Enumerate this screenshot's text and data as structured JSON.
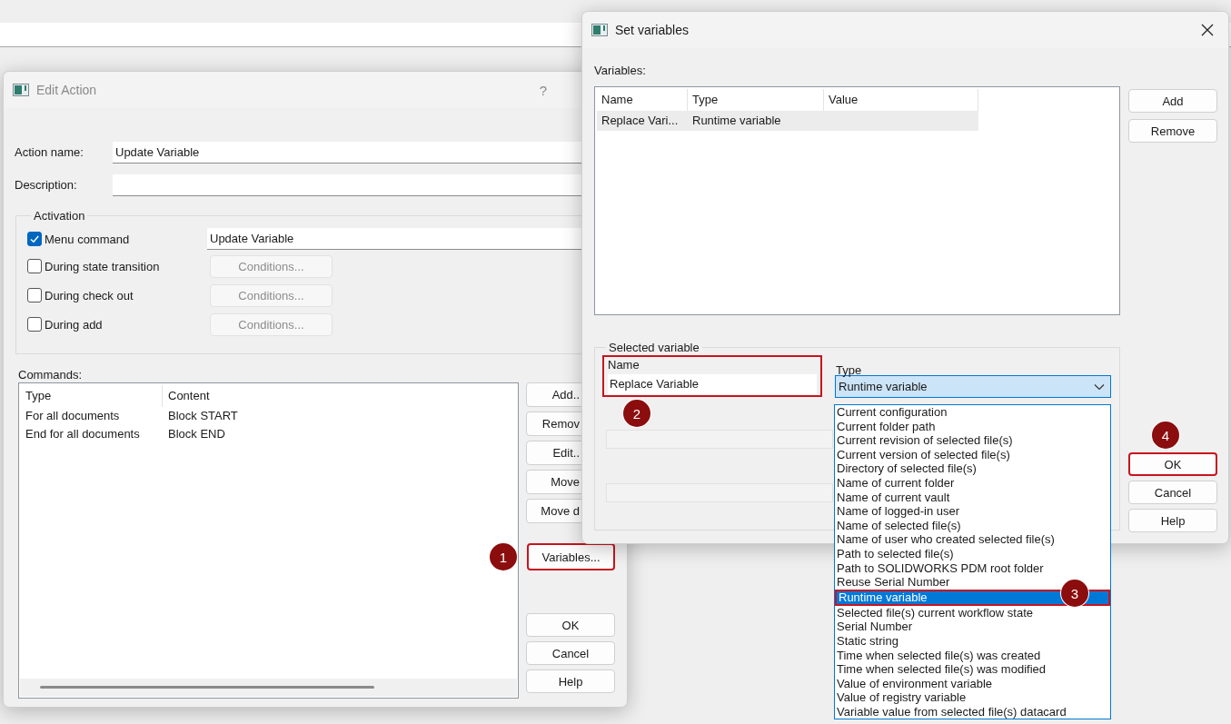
{
  "edit_action": {
    "title": "Edit Action",
    "help_glyph": "?",
    "fields": [
      {
        "label": "Action name:",
        "value": "Update Variable"
      },
      {
        "label": "Description:"
      }
    ],
    "activation": {
      "title": "Activation",
      "triggers": [
        {
          "label": "Menu command",
          "checked": true,
          "kind": "field",
          "value": "Update Variable"
        },
        {
          "label": "During state transition",
          "checked": false,
          "kind": "button",
          "button": "Conditions...",
          "disabled": true
        },
        {
          "label": "During check out",
          "checked": false,
          "kind": "button",
          "button": "Conditions...",
          "disabled": true
        },
        {
          "label": "During add",
          "checked": false,
          "kind": "button",
          "button": "Conditions...",
          "disabled": true
        }
      ]
    },
    "commands_label": "Commands:",
    "commands": {
      "columns": [
        "Type",
        "Content"
      ],
      "rows": [
        [
          "For all documents",
          "Block START"
        ],
        [
          "End for all documents",
          "Block END"
        ]
      ]
    },
    "side_buttons": [
      {
        "label": "Add.."
      },
      {
        "label": "Remov"
      },
      {
        "label": "Edit.."
      },
      {
        "label": "Move"
      },
      {
        "label": "Move d"
      },
      {
        "label": "Variables...",
        "annotation": {
          "badge": "1"
        }
      }
    ],
    "dialog_buttons": [
      {
        "label": "OK"
      },
      {
        "label": "Cancel"
      },
      {
        "label": "Help"
      }
    ]
  },
  "set_variables": {
    "title": "Set variables",
    "variables_label": "Variables:",
    "table": {
      "columns": [
        "Name",
        "Type",
        "Value"
      ],
      "rows": [
        {
          "cells": [
            "Replace Vari...",
            "Runtime variable"
          ],
          "selected": true
        }
      ]
    },
    "buttons": [
      {
        "label": "Add"
      },
      {
        "label": "Remove"
      }
    ],
    "selected_variable": {
      "title": "Selected variable",
      "name_label": "Name",
      "name_value": "Replace Variable",
      "name_annotation": {
        "badge": "2"
      },
      "type_label": "Type",
      "type_value": "Runtime variable",
      "options": [
        {
          "label": "Current configuration",
          "selected": false
        },
        {
          "label": "Current folder path",
          "selected": false
        },
        {
          "label": "Current revision of selected file(s)",
          "selected": false
        },
        {
          "label": "Current version of selected file(s)",
          "selected": false
        },
        {
          "label": "Directory of selected file(s)",
          "selected": false
        },
        {
          "label": "Name of current folder",
          "selected": false
        },
        {
          "label": "Name of current vault",
          "selected": false
        },
        {
          "label": "Name of logged-in user",
          "selected": false
        },
        {
          "label": "Name of selected file(s)",
          "selected": false
        },
        {
          "label": "Name of user who created selected file(s)",
          "selected": false
        },
        {
          "label": "Path to selected file(s)",
          "selected": false
        },
        {
          "label": "Path to SOLIDWORKS PDM root folder",
          "selected": false
        },
        {
          "label": "Reuse Serial Number",
          "selected": false
        },
        {
          "label": "Runtime variable",
          "selected": true,
          "annotation": {
            "badge": "3"
          }
        },
        {
          "label": "Selected file(s) current workflow state",
          "selected": false
        },
        {
          "label": "Serial Number",
          "selected": false
        },
        {
          "label": "Static string",
          "selected": false
        },
        {
          "label": "Time when selected file(s) was created",
          "selected": false
        },
        {
          "label": "Time when selected file(s) was modified",
          "selected": false
        },
        {
          "label": "Value of environment variable",
          "selected": false
        },
        {
          "label": "Value of registry variable",
          "selected": false
        },
        {
          "label": "Variable value from selected file(s) datacard",
          "selected": false
        }
      ]
    },
    "dialog_buttons": [
      {
        "label": "OK",
        "annotation": {
          "badge": "4"
        }
      },
      {
        "label": "Cancel"
      },
      {
        "label": "Help"
      }
    ]
  }
}
